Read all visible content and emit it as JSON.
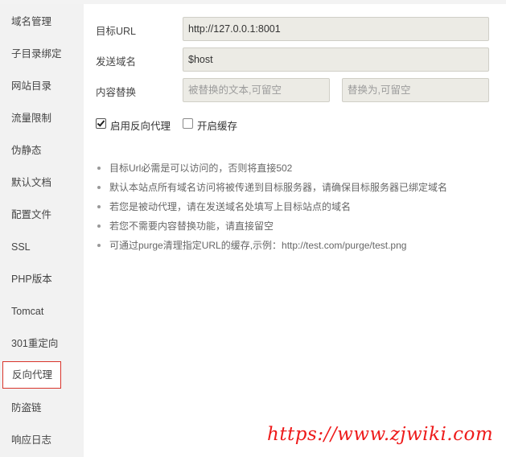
{
  "sidebar": {
    "items": [
      {
        "label": "域名管理"
      },
      {
        "label": "子目录绑定"
      },
      {
        "label": "网站目录"
      },
      {
        "label": "流量限制"
      },
      {
        "label": "伪静态"
      },
      {
        "label": "默认文档"
      },
      {
        "label": "配置文件"
      },
      {
        "label": "SSL"
      },
      {
        "label": "PHP版本"
      },
      {
        "label": "Tomcat"
      },
      {
        "label": "301重定向"
      },
      {
        "label": "反向代理",
        "active": true
      },
      {
        "label": "防盗链"
      },
      {
        "label": "响应日志"
      }
    ]
  },
  "form": {
    "target_url_label": "目标URL",
    "target_url_value": "http://127.0.0.1:8001",
    "send_domain_label": "发送域名",
    "send_domain_value": "$host",
    "replace_label": "内容替换",
    "replace_from_placeholder": "被替换的文本,可留空",
    "replace_to_placeholder": "替换为,可留空",
    "enable_proxy_label": "启用反向代理",
    "enable_proxy_checked": true,
    "enable_cache_label": "开启缓存",
    "enable_cache_checked": false
  },
  "tips": [
    "目标Url必需是可以访问的，否则将直接502",
    "默认本站点所有域名访问将被传递到目标服务器，请确保目标服务器已绑定域名",
    "若您是被动代理，请在发送域名处填写上目标站点的域名",
    "若您不需要内容替换功能，请直接留空",
    "可通过purge清理指定URL的缓存,示例：http://test.com/purge/test.png"
  ],
  "watermark": "https://www.zjwiki.com",
  "colors": {
    "sidebar_bg": "#f2f2f2",
    "active_border": "#d9342b",
    "field_bg": "#ecebe5",
    "watermark": "#ee1b1b"
  }
}
